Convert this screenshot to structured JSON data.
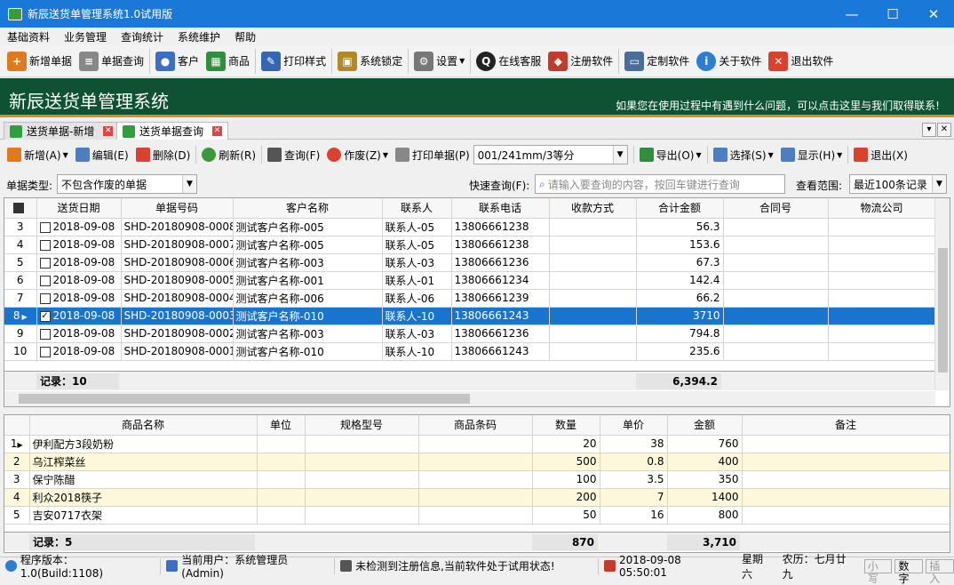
{
  "window": {
    "title": "新辰送货单管理系统1.0试用版",
    "min": "—",
    "max": "☐",
    "close": "✕"
  },
  "menu": [
    "基础资料",
    "业务管理",
    "查询统计",
    "系统维护",
    "帮助"
  ],
  "toolbar": [
    {
      "label": "新增单据",
      "icon": "new-doc-icon",
      "color": "#e07a1e"
    },
    {
      "label": "单据查询",
      "icon": "query-doc-icon",
      "color": "#777777"
    },
    {
      "label": "客户",
      "icon": "customers-icon",
      "color": "#3a6fc4"
    },
    {
      "label": "商品",
      "icon": "goods-icon",
      "color": "#2f8f3f"
    },
    {
      "label": "打印样式",
      "icon": "print-style-icon",
      "color": "#3466b2"
    },
    {
      "label": "系统锁定",
      "icon": "lock-icon",
      "color": "#b08a2a"
    },
    {
      "label": "设置",
      "icon": "gear-icon",
      "color": "#777777"
    },
    {
      "label": "在线客服",
      "icon": "qq-icon",
      "color": "#222222"
    },
    {
      "label": "注册软件",
      "icon": "register-icon",
      "color": "#c23b2b"
    },
    {
      "label": "定制软件",
      "icon": "custom-icon",
      "color": "#4a6d9a"
    },
    {
      "label": "关于软件",
      "icon": "info-icon",
      "color": "#2a7fd4"
    },
    {
      "label": "退出软件",
      "icon": "exit-icon",
      "color": "#d9432e"
    }
  ],
  "banner": {
    "title": "新辰送货单管理系统",
    "tip": "如果您在使用过程中有遇到什么问题，可以点击这里与我们取得联系!"
  },
  "tabs": [
    {
      "label": "送货单据-新增"
    },
    {
      "label": "送货单据查询"
    }
  ],
  "subtoolbar": {
    "add": "新增(A)",
    "edit": "编辑(E)",
    "delete": "删除(D)",
    "refresh": "刷新(R)",
    "query": "查询(F)",
    "void": "作废(Z)",
    "print": "打印单据(P)",
    "print_format": "001/241mm/3等分",
    "export": "导出(O)",
    "select": "选择(S)",
    "display": "显示(H)",
    "exit": "退出(X)"
  },
  "filter": {
    "type_label": "单据类型:",
    "type_value": "不包含作废的单据",
    "quick_label": "快速查询(F):",
    "quick_placeholder": "请输入要查询的内容，按回车键进行查询",
    "range_label": "查看范围:",
    "range_value": "最近100条记录"
  },
  "grid1": {
    "columns": [
      "送货日期",
      "单据号码",
      "客户名称",
      "联系人",
      "联系电话",
      "收款方式",
      "合计金额",
      "合同号",
      "物流公司"
    ],
    "rows": [
      {
        "no": "3",
        "date": "2018-09-08",
        "code": "SHD-20180908-0008",
        "customer": "测试客户名称-005",
        "contact": "联系人-05",
        "phone": "13806661238",
        "pay": "",
        "total": "56.3",
        "checked": false
      },
      {
        "no": "4",
        "date": "2018-09-08",
        "code": "SHD-20180908-0007",
        "customer": "测试客户名称-005",
        "contact": "联系人-05",
        "phone": "13806661238",
        "pay": "",
        "total": "153.6",
        "checked": false
      },
      {
        "no": "5",
        "date": "2018-09-08",
        "code": "SHD-20180908-0006",
        "customer": "测试客户名称-003",
        "contact": "联系人-03",
        "phone": "13806661236",
        "pay": "",
        "total": "67.3",
        "checked": false
      },
      {
        "no": "6",
        "date": "2018-09-08",
        "code": "SHD-20180908-0005",
        "customer": "测试客户名称-001",
        "contact": "联系人-01",
        "phone": "13806661234",
        "pay": "",
        "total": "142.4",
        "checked": false
      },
      {
        "no": "7",
        "date": "2018-09-08",
        "code": "SHD-20180908-0004",
        "customer": "测试客户名称-006",
        "contact": "联系人-06",
        "phone": "13806661239",
        "pay": "",
        "total": "66.2",
        "checked": false
      },
      {
        "no": "8",
        "date": "2018-09-08",
        "code": "SHD-20180908-0003",
        "customer": "测试客户名称-010",
        "contact": "联系人-10",
        "phone": "13806661243",
        "pay": "",
        "total": "3710",
        "checked": true
      },
      {
        "no": "9",
        "date": "2018-09-08",
        "code": "SHD-20180908-0002",
        "customer": "测试客户名称-003",
        "contact": "联系人-03",
        "phone": "13806661236",
        "pay": "",
        "total": "794.8",
        "checked": false
      },
      {
        "no": "10",
        "date": "2018-09-08",
        "code": "SHD-20180908-0001",
        "customer": "测试客户名称-010",
        "contact": "联系人-10",
        "phone": "13806661243",
        "pay": "",
        "total": "235.6",
        "checked": false
      }
    ],
    "summary_count": "记录：10",
    "summary_total": "6,394.2"
  },
  "grid2": {
    "columns": [
      "商品名称",
      "单位",
      "规格型号",
      "商品条码",
      "数量",
      "单价",
      "金额",
      "备注"
    ],
    "rows": [
      {
        "no": "1",
        "name": "伊利配方3段奶粉",
        "qty": "20",
        "price": "38",
        "amount": "760"
      },
      {
        "no": "2",
        "name": "乌江榨菜丝",
        "qty": "500",
        "price": "0.8",
        "amount": "400"
      },
      {
        "no": "3",
        "name": "保宁陈醋",
        "qty": "100",
        "price": "3.5",
        "amount": "350"
      },
      {
        "no": "4",
        "name": "利众2018筷子",
        "qty": "200",
        "price": "7",
        "amount": "1400"
      },
      {
        "no": "5",
        "name": "吉安0717衣架",
        "qty": "50",
        "price": "16",
        "amount": "800"
      }
    ],
    "summary_count": "记录：5",
    "summary_qty": "870",
    "summary_amount": "3,710"
  },
  "status": {
    "version": "程序版本：1.0(Build:1108)",
    "user": "当前用户：系统管理员(Admin)",
    "reg": "未检测到注册信息,当前软件处于试用状态!",
    "datetime": "2018-09-08 05:50:01",
    "weekday": "星期六",
    "lunar": "农历：七月廿九",
    "caps": "小写",
    "num": "数字",
    "ins": "插入"
  }
}
